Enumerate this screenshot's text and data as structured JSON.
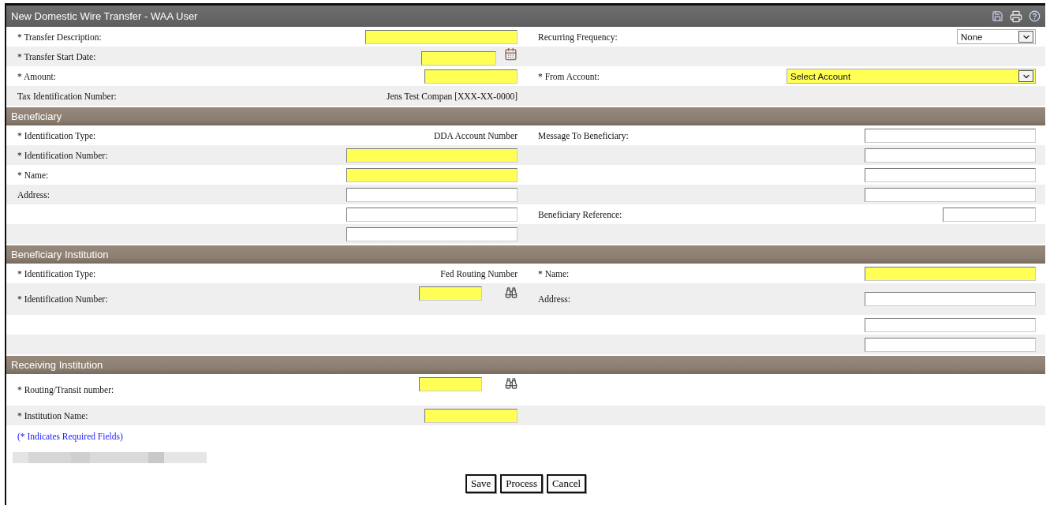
{
  "title": "New Domestic Wire Transfer - WAA User",
  "sections": [
    {
      "rows": [
        {
          "left": {
            "label": "* Transfer Description:",
            "control": {
              "kind": "longinput",
              "required": true
            }
          },
          "right": {
            "label": "Recurring Frequency:",
            "control": {
              "kind": "smallselect",
              "value": "None",
              "required": false
            }
          }
        },
        {
          "left": {
            "label": "* Transfer Start Date:",
            "control": {
              "kind": "date",
              "required": true
            }
          }
        },
        {
          "left": {
            "label": "* Amount:",
            "control": {
              "kind": "midinput",
              "required": true
            }
          },
          "right": {
            "label": "* From Account:",
            "control": {
              "kind": "wideselect",
              "value": "Select Account",
              "required": true
            }
          }
        },
        {
          "left": {
            "label": "Tax Identification Number:",
            "control": {
              "kind": "text",
              "value": "Jens Test Compan [XXX-XX-0000]"
            }
          }
        }
      ]
    },
    {
      "heading": "Beneficiary",
      "rows": [
        {
          "left": {
            "label": "* Identification Type:",
            "control": {
              "kind": "text",
              "value": "DDA Account Number"
            }
          },
          "right": {
            "label": "Message To Beneficiary:",
            "control": {
              "kind": "wideinput",
              "required": false
            }
          }
        },
        {
          "left": {
            "label": "* Identification Number:",
            "control": {
              "kind": "wideinput",
              "required": true
            }
          },
          "right": {
            "control": {
              "kind": "wideinput",
              "required": false
            }
          }
        },
        {
          "left": {
            "label": "* Name:",
            "control": {
              "kind": "wideinput",
              "required": true
            }
          },
          "right": {
            "control": {
              "kind": "wideinput",
              "required": false
            }
          }
        },
        {
          "left": {
            "label": "Address:",
            "control": {
              "kind": "wideinput",
              "required": false
            }
          },
          "right": {
            "control": {
              "kind": "wideinput",
              "required": false
            }
          }
        },
        {
          "left": {
            "control": {
              "kind": "wideinput",
              "required": false
            }
          },
          "right": {
            "label": "Beneficiary Reference:",
            "control": {
              "kind": "midinput",
              "required": false
            }
          }
        },
        {
          "left": {
            "control": {
              "kind": "wideinput",
              "required": false
            }
          }
        }
      ]
    },
    {
      "heading": "Beneficiary Institution",
      "rows": [
        {
          "left": {
            "label": "* Identification Type:",
            "control": {
              "kind": "text",
              "value": "Fed Routing Number"
            }
          },
          "right": {
            "label": "* Name:",
            "control": {
              "kind": "wideinput",
              "required": true
            }
          }
        },
        {
          "left": {
            "label": "* Identification Number:",
            "control": {
              "kind": "lookup",
              "required": true
            }
          },
          "right": {
            "label": "Address:",
            "control": {
              "kind": "wideinput",
              "required": false
            }
          }
        },
        {
          "right": {
            "control": {
              "kind": "wideinput",
              "required": false
            }
          }
        },
        {
          "right": {
            "control": {
              "kind": "wideinput",
              "required": false
            }
          }
        }
      ]
    },
    {
      "heading": "Receiving Institution",
      "rows": [
        {
          "left": {
            "label": "* Routing/Transit number:",
            "control": {
              "kind": "lookup",
              "required": true
            }
          }
        },
        {
          "left": {
            "label": "* Institution Name:",
            "control": {
              "kind": "midinput",
              "required": true
            }
          }
        }
      ]
    }
  ],
  "note": "(* Indicates Required Fields)",
  "buttons": [
    "Save",
    "Process",
    "Cancel"
  ]
}
